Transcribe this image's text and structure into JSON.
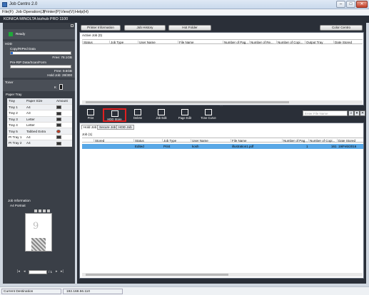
{
  "window": {
    "title": "Job Centro 2.0"
  },
  "menu": [
    "File(F)",
    "Job Operation(J)",
    "Printer(P)",
    "View(V)",
    "Help(H)"
  ],
  "device": {
    "name": "KONICA MINOLTA bizhub PRO 1100"
  },
  "status": {
    "label": "Ready",
    "color": "#1faa3a"
  },
  "hdd": {
    "title": "HDD",
    "copy_label": "Copy/RIPed Data",
    "copy_free": "Free: 78.1GB",
    "copy_used_fraction": 0.04,
    "prerip_label": "Pre-RIP Data/Scan/Form",
    "prerip_free": "Free: 9.6GB",
    "hold_job": "Hold Job: 28/300"
  },
  "toner": {
    "title": "Toner",
    "code": "K"
  },
  "paper_tray": {
    "title": "Paper Tray",
    "headers": [
      "Tray",
      "Paper Size",
      "Amount"
    ],
    "rows": [
      {
        "tray": "Tray 1",
        "size": "A4",
        "icon": "paper-stack-icon"
      },
      {
        "tray": "Tray 2",
        "size": "A3",
        "icon": "paper-stack-icon"
      },
      {
        "tray": "Tray 3",
        "size": "Letter",
        "icon": "paper-stack-icon"
      },
      {
        "tray": "Tray 4",
        "size": "Letter",
        "icon": "paper-stack-icon"
      },
      {
        "tray": "Tray 5",
        "size": "Tabbed Extra",
        "icon": "tray-empty-icon"
      },
      {
        "tray": "PI Tray 1",
        "size": "A4",
        "icon": "paper-stack-icon"
      },
      {
        "tray": "PI Tray 2",
        "size": "A4",
        "icon": "paper-stack-icon"
      }
    ]
  },
  "job_info": {
    "title": "Job Information",
    "paper": "A4 Portrait",
    "preview_number": "9",
    "page_of": "/ 1"
  },
  "top_buttons": {
    "printer_information": "Printer Information",
    "job_history": "Job History",
    "hot_folder": "Hot Folder",
    "color_centro": "Color Centro"
  },
  "active_job": {
    "title": "Active Job (0)",
    "columns": [
      "Status",
      "Job Type",
      "User Name",
      "File Name",
      "Number of Pag...",
      "Number of Re...",
      "Number of Copi...",
      "Output Tray",
      "Date Stored"
    ]
  },
  "toolbar": {
    "print": "Print",
    "hdd_store": "HDD Store",
    "delete": "Delete",
    "job_edit": "Job Edit",
    "page_edit": "Page Edit",
    "tone_curve": "Tone Curve",
    "search_placeholder": "Enter File Name"
  },
  "hold_tabs": [
    "Hold Job",
    "Secure Job",
    "HDD Job"
  ],
  "hold_job": {
    "count_label": "Job (1)",
    "columns": [
      "Stored",
      "Status",
      "Job Type",
      "User Name",
      "File Name",
      "Number of Pag...",
      "Number of Copi...",
      "Date Stored"
    ],
    "rows": [
      {
        "status": "Edited",
        "type": "Print",
        "user": "kosh",
        "file": "illustration1.pdf",
        "pages": "1",
        "copies": "161",
        "date": "19/Feb/2016"
      }
    ]
  },
  "statusbar": {
    "current_destination": "Current Destination",
    "ip": "192.168.56.110"
  }
}
